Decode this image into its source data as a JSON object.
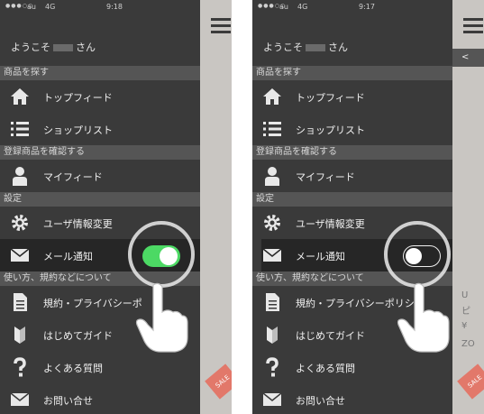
{
  "screens": [
    {
      "status": {
        "signal": "●●●○○",
        "carrier": "au",
        "network": "4G",
        "time": "9:18"
      },
      "welcome": {
        "prefix": "ようこそ",
        "suffix": "さん"
      },
      "sections": {
        "browse": "商品を探す",
        "registered": "登録商品を確認する",
        "settings": "設定",
        "help": "使い方、規約などについて"
      },
      "items": {
        "top_feed": "トップフィード",
        "shop_list": "ショップリスト",
        "my_feed": "マイフィード",
        "user_info": "ユーザ情報変更",
        "mail_notice": "メール通知",
        "terms": "規約・プライバシーポ",
        "guide": "はじめてガイド",
        "faq": "よくある質問",
        "contact": "お問い合せ"
      },
      "toggle": {
        "state": "on",
        "color": "#4cd964"
      },
      "behind": {
        "sale": "SALE"
      }
    },
    {
      "status": {
        "signal": "●●●○○",
        "carrier": "au",
        "network": "4G",
        "time": "9:17"
      },
      "welcome": {
        "prefix": "ようこそ",
        "suffix": "さん"
      },
      "sections": {
        "browse": "商品を探す",
        "registered": "登録商品を確認する",
        "settings": "設定",
        "help": "使い方、規約などについて"
      },
      "items": {
        "top_feed": "トップフィード",
        "shop_list": "ショップリスト",
        "my_feed": "マイフィード",
        "user_info": "ユーザ情報変更",
        "mail_notice": "メール通知",
        "terms": "規約・プライバシーポリシ",
        "guide": "はじめてガイド",
        "faq": "よくある質問",
        "contact": "お問い合せ"
      },
      "toggle": {
        "state": "off"
      },
      "behind": {
        "back": "<",
        "peek_1": "U",
        "peek_2": "ピ",
        "peek_3": "¥",
        "peek_4": "ZO",
        "sale": "SALE"
      }
    }
  ]
}
